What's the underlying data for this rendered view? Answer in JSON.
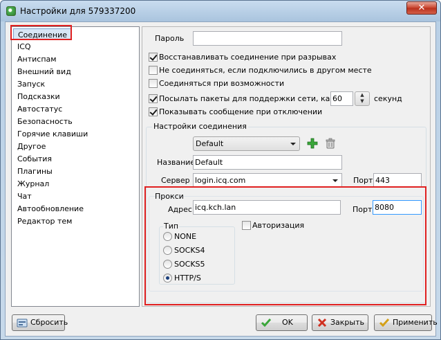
{
  "window": {
    "title": "Настройки для 579337200",
    "close_label": "✕"
  },
  "nav": {
    "items": [
      {
        "label": "Соединение"
      },
      {
        "label": "ICQ"
      },
      {
        "label": "Антиспам"
      },
      {
        "label": "Внешний вид"
      },
      {
        "label": "Запуск"
      },
      {
        "label": "Подсказки"
      },
      {
        "label": "Автостатус"
      },
      {
        "label": "Безопасность"
      },
      {
        "label": "Горячие клавиши"
      },
      {
        "label": "Другое"
      },
      {
        "label": "События"
      },
      {
        "label": "Плагины"
      },
      {
        "label": "Журнал"
      },
      {
        "label": "Чат"
      },
      {
        "label": "Автообновление"
      },
      {
        "label": "Редактор тем"
      }
    ],
    "selected": "Соединение"
  },
  "connection": {
    "password_label": "Пароль",
    "password_value": "",
    "options": [
      {
        "label": "Восстанавливать соединение при разрывах",
        "checked": true
      },
      {
        "label": "Не соединяться, если подключились в другом месте",
        "checked": false
      },
      {
        "label": "Соединяться при возможности",
        "checked": false
      },
      {
        "label": "Посылать пакеты для поддержки сети, каждые",
        "checked": true
      },
      {
        "label": "Показывать сообщение при отключении",
        "checked": true
      }
    ],
    "keepalive_value": "60",
    "keepalive_unit": "секунд",
    "settings_group": {
      "title": "Настройки соединения",
      "profile": "Default",
      "name_label": "Название",
      "name_value": "Default",
      "server_label": "Сервер",
      "server_value": "login.icq.com",
      "port_label": "Порт",
      "port_value": "443"
    },
    "proxy": {
      "title": "Прокси",
      "address_label": "Адрес",
      "address_value": "icq.kch.lan",
      "port_label": "Порт",
      "port_value": "8080",
      "auth_label": "Авторизация",
      "auth_checked": false,
      "type_title": "Тип",
      "types": [
        {
          "label": "NONE",
          "selected": false
        },
        {
          "label": "SOCKS4",
          "selected": false
        },
        {
          "label": "SOCKS5",
          "selected": false
        },
        {
          "label": "HTTP/S",
          "selected": true
        }
      ]
    }
  },
  "buttons": {
    "reset": "Сбросить",
    "ok": "OK",
    "close": "Закрыть",
    "apply": "Применить"
  },
  "colors": {
    "highlight": "#e02020",
    "add_icon": "#2ea02e"
  }
}
